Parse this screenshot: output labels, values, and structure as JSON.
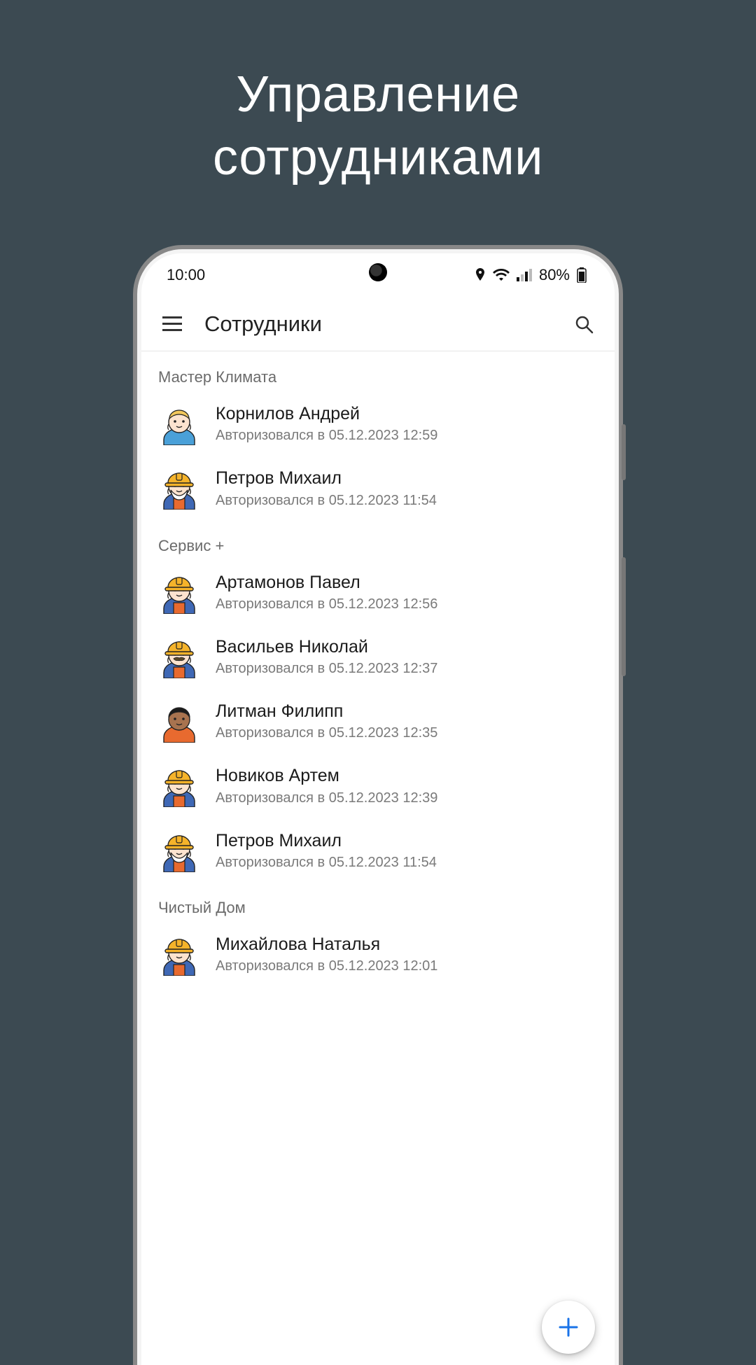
{
  "promo": {
    "line1": "Управление",
    "line2": "сотрудниками"
  },
  "status": {
    "time": "10:00",
    "battery_pct": "80%"
  },
  "app_bar": {
    "title": "Сотрудники"
  },
  "groups": [
    {
      "title": "Мастер Климата",
      "employees": [
        {
          "name": "Корнилов Андрей",
          "sub": "Авторизовался в 05.12.2023 12:59",
          "avatar": "blue-worker-nohat"
        },
        {
          "name": "Петров Михаил",
          "sub": "Авторизовался в 05.12.2023 11:54",
          "avatar": "orange-worker-beard"
        }
      ]
    },
    {
      "title": "Сервис +",
      "employees": [
        {
          "name": "Артамонов Павел",
          "sub": "Авторизовался в 05.12.2023 12:56",
          "avatar": "orange-worker"
        },
        {
          "name": "Васильев Николай",
          "sub": "Авторизовался в 05.12.2023 12:37",
          "avatar": "orange-worker-mustache"
        },
        {
          "name": "Литман Филипп",
          "sub": "Авторизовался в 05.12.2023 12:35",
          "avatar": "dark-worker-nohat"
        },
        {
          "name": "Новиков Артем",
          "sub": "Авторизовался в 05.12.2023 12:39",
          "avatar": "orange-worker"
        },
        {
          "name": "Петров Михаил",
          "sub": "Авторизовался в 05.12.2023 11:54",
          "avatar": "orange-worker-beard"
        }
      ]
    },
    {
      "title": "Чистый Дом",
      "employees": [
        {
          "name": "Михайлова Наталья",
          "sub": "Авторизовался в 05.12.2023 12:01",
          "avatar": "orange-worker"
        }
      ]
    }
  ],
  "colors": {
    "accent": "#1a73e8",
    "bg": "#3c4a52"
  }
}
